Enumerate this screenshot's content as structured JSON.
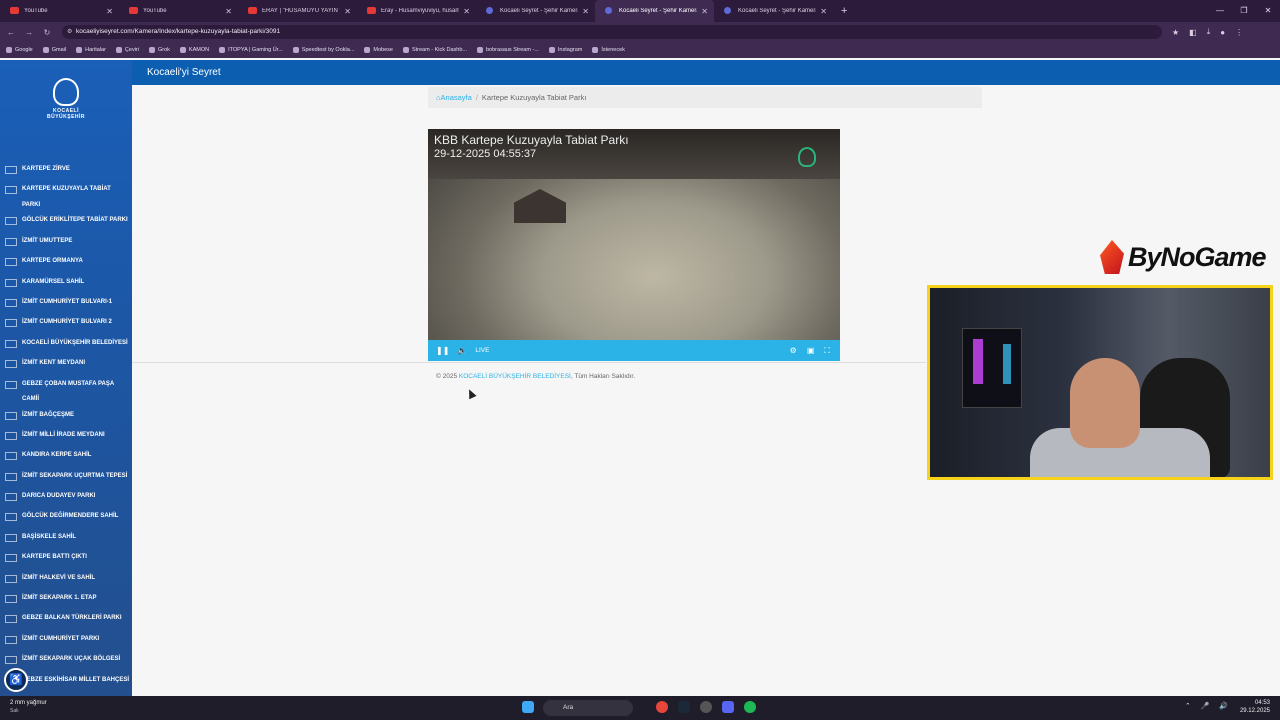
{
  "browser": {
    "tabs": [
      {
        "label": "YouTube",
        "icon": "youtube-icon",
        "active": false
      },
      {
        "label": "YouTube",
        "icon": "youtube-icon",
        "active": false
      },
      {
        "label": "ERAY | \"HUSAMUYU YAYIN V...",
        "icon": "youtube-icon",
        "active": false
      },
      {
        "label": "Eray - Husamviyuviyu, husamy...",
        "icon": "youtube-icon",
        "active": false
      },
      {
        "label": "Kocaeli Seyret - Şehir Kamera...",
        "icon": "globe-icon",
        "active": false
      },
      {
        "label": "Kocaeli Seyret - Şehir Kamera...",
        "icon": "globe-icon",
        "active": true
      },
      {
        "label": "Kocaeli Seyret - Şehir Kamera...",
        "icon": "globe-icon",
        "active": false
      }
    ],
    "url": "kocaeliyiseyret.com/Kamera/Index/kartepe-kuzuyayla-tabiat-parki/3091",
    "bookmarks": [
      "Google",
      "Gmail",
      "Haritalar",
      "Çeviri",
      "Grok",
      "KAMON",
      "ITOPYA | Gaming Ür...",
      "Speedtest by Ookla...",
      "Mobese",
      "Stream - Kick Dashb...",
      "bobrasaus Stream -...",
      "Instagram",
      "İstenecek"
    ]
  },
  "site": {
    "title": "Kocaeli'yi Seyret",
    "logo_text": "KOCAELİ BÜYÜKŞEHİR",
    "menu": [
      "KARTEPE ZİRVE",
      "KARTEPE KUZUYAYLA TABİAT PARKI",
      "GÖLCÜK ERİKLİTEPE TABİAT PARKI",
      "İZMİT UMUTTEPE",
      "KARTEPE ORMANYA",
      "KARAMÜRSEL SAHİL",
      "İZMİT CUMHURİYET BULVARI-1",
      "İZMİT CUMHURİYET BULVARI 2",
      "KOCAELİ BÜYÜKŞEHİR BELEDİYESİ",
      "İZMİT KENT MEYDANI",
      "GEBZE ÇOBAN MUSTAFA PAŞA CAMİİ",
      "İZMİT BAĞÇEŞME",
      "İZMİT MİLLİ İRADE MEYDANI",
      "KANDIRA KERPE SAHİL",
      "İZMİT SEKAPARK UÇURTMA TEPESİ",
      "DARICA DUDAYEV PARKI",
      "GÖLCÜK DEĞİRMENDERE SAHİL",
      "BAŞİSKELE SAHİL",
      "KARTEPE BATTI ÇIKTI",
      "İZMİT HALKEVİ VE SAHİL",
      "İZMİT SEKAPARK 1. ETAP",
      "GEBZE BALKAN TÜRKLERİ PARKI",
      "İZMİT CUMHURİYET PARKI",
      "İZMİT SEKAPARK UÇAK BÖLGESİ",
      "GEBZE ESKİHİSAR MİLLET BAHÇESİ"
    ],
    "breadcrumb": {
      "home": "Anasayfa",
      "separator": "/",
      "current": "Kartepe Kuzuyayla Tabiat Parkı"
    },
    "player": {
      "overlay_title": "KBB Kartepe Kuzuyayla Tabiat Parkı",
      "overlay_time": "29-12-2025 04:55:37",
      "live_label": "LIVE"
    },
    "footer": {
      "prefix": "© 2025",
      "org": "KOCAELİ BÜYÜKŞEHİR BELEDİYESİ",
      "suffix": ", Tüm Hakları Saklıdır."
    }
  },
  "stream": {
    "brand": "ByNoGame"
  },
  "taskbar": {
    "weather_temp": "2 mm yağmur",
    "weather_sub": "Salı",
    "search_placeholder": "Ara",
    "time": "04:53",
    "date": "29.12.2025"
  },
  "colors": {
    "accent": "#2bb2e6",
    "header": "#0c5fb0",
    "webcam_border": "#f6d21a"
  }
}
